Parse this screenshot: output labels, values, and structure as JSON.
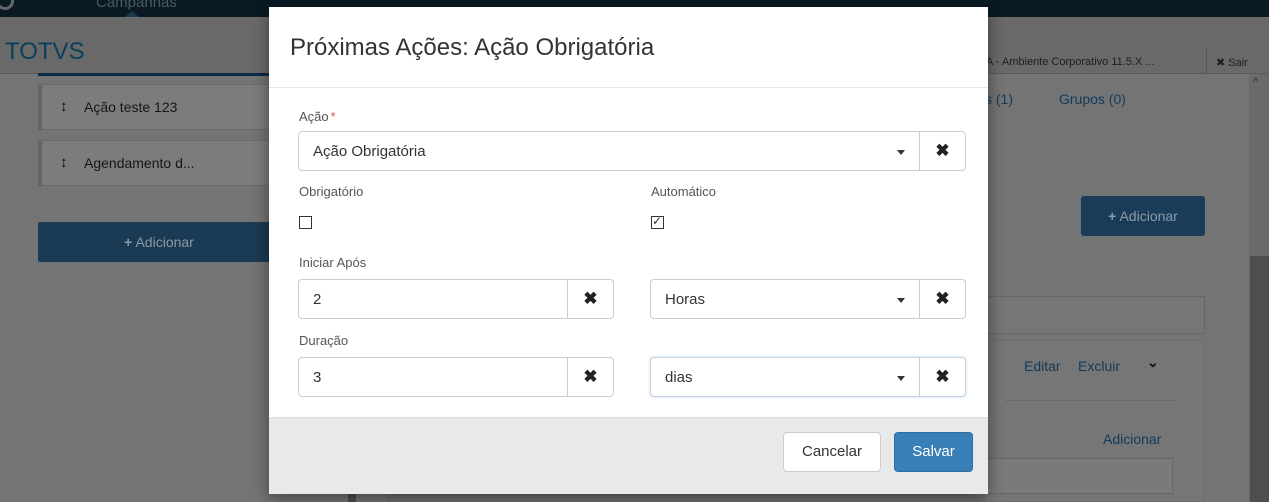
{
  "app": {
    "topbar_tab": "Campanhas",
    "brand": "TOTVS",
    "environment": "A - Ambiente Corporativo 11.5.X ...",
    "logout": "✖ Sair"
  },
  "left_list": {
    "items": [
      {
        "label": "Ação teste 123"
      },
      {
        "label": "Agendamento d..."
      }
    ],
    "add_button": "Adicionar"
  },
  "right_panel": {
    "tab_partial": "s (1)",
    "groups_tab": "Grupos (0)",
    "add_button": "Adicionar",
    "edit_link": "Editar",
    "delete_link": "Excluir",
    "add_link": "Adicionar"
  },
  "modal": {
    "title": "Próximas Ações: Ação Obrigatória",
    "acao": {
      "label": "Ação",
      "required_mark": "*",
      "value": "Ação Obrigatória"
    },
    "obrigatorio": {
      "label": "Obrigatório",
      "checked": false
    },
    "automatico": {
      "label": "Automático",
      "checked": true
    },
    "iniciar_apos": {
      "label": "Iniciar Após",
      "value": "2",
      "unit": "Horas"
    },
    "duracao": {
      "label": "Duração",
      "value": "3",
      "unit": "dias"
    },
    "cancel_button": "Cancelar",
    "save_button": "Salvar"
  },
  "icons": {
    "clear": "✖",
    "checkmark": "✓",
    "sort": "↕",
    "plus": "+"
  }
}
